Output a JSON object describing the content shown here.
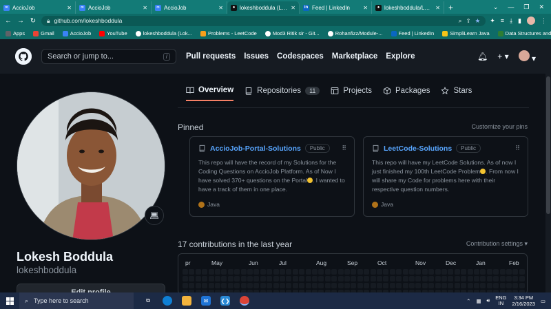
{
  "browser": {
    "tabs": [
      {
        "title": "AccioJob",
        "color": "#3b82f6",
        "glyph": "∞",
        "active": false
      },
      {
        "title": "AccioJob",
        "color": "#3b82f6",
        "glyph": "∞",
        "active": false
      },
      {
        "title": "AccioJob",
        "color": "#3b82f6",
        "glyph": "∞",
        "active": false
      },
      {
        "title": "lokeshboddula (Lokesh",
        "color": "#111111",
        "glyph": "●",
        "active": true
      },
      {
        "title": "Feed | LinkedIn",
        "color": "#0a66c2",
        "glyph": "in",
        "active": false
      },
      {
        "title": "lokeshboddula/LeetCo",
        "color": "#111111",
        "glyph": "●",
        "active": false
      }
    ],
    "url": "github.com/lokeshboddula",
    "bookmarks": [
      {
        "label": "Apps",
        "color": "#5f6368"
      },
      {
        "label": "Gmail",
        "color": "#ea4335"
      },
      {
        "label": "AccioJob",
        "color": "#3b82f6"
      },
      {
        "label": "YouTube",
        "color": "#ff0000"
      },
      {
        "label": "lokeshboddula (Lok...",
        "color": "#111111"
      },
      {
        "label": "Problems - LeetCode",
        "color": "#f89f1b"
      },
      {
        "label": "Mod3 Ritik sir - Git...",
        "color": "#111111"
      },
      {
        "label": "Rohanfizz/Module-...",
        "color": "#111111"
      },
      {
        "label": "Feed | LinkedIn",
        "color": "#0a66c2"
      },
      {
        "label": "SimpliLearn Java",
        "color": "#f5c518"
      },
      {
        "label": "Data Structures and...",
        "color": "#2e7d32"
      }
    ]
  },
  "header": {
    "search_placeholder": "Search or jump to...",
    "slash_hint": "/",
    "nav": [
      "Pull requests",
      "Issues",
      "Codespaces",
      "Marketplace",
      "Explore"
    ]
  },
  "profile_tabs": {
    "overview": "Overview",
    "repositories": "Repositories",
    "repositories_count": "11",
    "projects": "Projects",
    "packages": "Packages",
    "stars": "Stars"
  },
  "profile": {
    "fullname": "Lokesh Boddula",
    "username": "lokeshboddula",
    "edit_button": "Edit profile"
  },
  "pinned": {
    "title": "Pinned",
    "customize": "Customize your pins",
    "repos": [
      {
        "name": "AccioJob-Portal-Solutions",
        "visibility": "Public",
        "desc_a": "This repo will have the record of my Solutions for the Coding Questions on AccioJob Platform. As of Now I have solved 370+ questions on the Portal",
        "desc_b": ". I wanted to have a track of them in one place.",
        "language": "Java"
      },
      {
        "name": "LeetCode-Solutions",
        "visibility": "Public",
        "desc_a": "This repo will have my LeetCode Solutions. As of now I just finished my 100th LeetCode Problem",
        "desc_b": ". From now I will share my Code for problems here with their respective question numbers.",
        "language": "Java"
      }
    ]
  },
  "contributions": {
    "title": "17 contributions in the last year",
    "settings": "Contribution settings",
    "months": [
      "pr",
      "May",
      "Jun",
      "Jul",
      "Aug",
      "Sep",
      "Oct",
      "Nov",
      "Dec",
      "Jan",
      "Feb"
    ]
  },
  "taskbar": {
    "search_placeholder": "Type here to search",
    "lang_top": "ENG",
    "lang_bottom": "IN",
    "time": "3:34 PM",
    "date": "2/16/2023"
  },
  "colors": {
    "accent_link": "#58a6ff",
    "tab_underline": "#f78166",
    "java": "#b07219",
    "browser_frame": "#137b77"
  }
}
